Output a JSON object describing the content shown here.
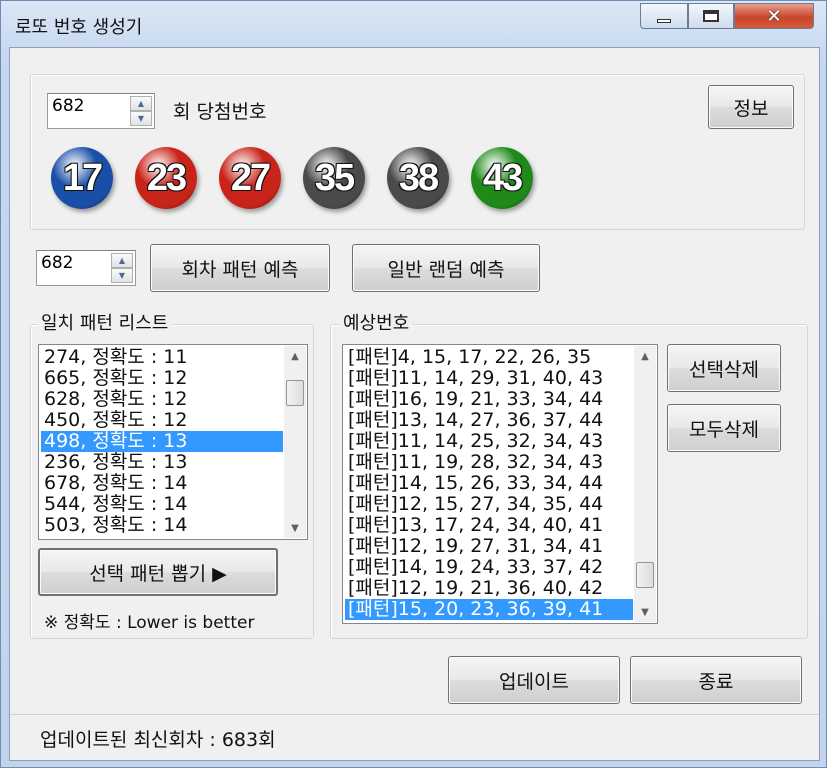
{
  "window": {
    "title": "로또 번호 생성기"
  },
  "top": {
    "round_value": "682",
    "round_suffix": "회 당첨번호",
    "info_button": "정보",
    "balls": [
      {
        "number": "17",
        "color": "#1a4fa8"
      },
      {
        "number": "23",
        "color": "#c9241a"
      },
      {
        "number": "27",
        "color": "#c9241a"
      },
      {
        "number": "35",
        "color": "#4a4a4a"
      },
      {
        "number": "38",
        "color": "#4a4a4a"
      },
      {
        "number": "43",
        "color": "#1f8a1a"
      }
    ]
  },
  "predict": {
    "round_value": "682",
    "pattern_button": "회차 패턴 예측",
    "random_button": "일반 랜덤 예측"
  },
  "pattern_list": {
    "label": "일치 패턴 리스트",
    "items": [
      "274, 정확도 : 11",
      "665, 정확도 : 12",
      "628, 정확도 : 12",
      "450, 정확도 : 12",
      "498, 정확도 : 13",
      "236, 정확도 : 13",
      "678, 정확도 : 14",
      "544, 정확도 : 14",
      "503, 정확도 : 14"
    ],
    "selected_index": 4,
    "extract_button": "선택 패턴 뽑기 ▶",
    "note": "※ 정확도 : Lower is better"
  },
  "predicted": {
    "label": "예상번호",
    "items": [
      "[패턴]4, 15, 17, 22, 26, 35",
      "[패턴]11, 14, 29, 31, 40, 43",
      "[패턴]16, 19, 21, 33, 34, 44",
      "[패턴]13, 14, 27, 36, 37, 44",
      "[패턴]11, 14, 25, 32, 34, 43",
      "[패턴]11, 19, 28, 32, 34, 43",
      "[패턴]14, 15, 26, 33, 34, 44",
      "[패턴]12, 15, 27, 34, 35, 44",
      "[패턴]13, 17, 24, 34, 40, 41",
      "[패턴]12, 19, 27, 31, 34, 41",
      "[패턴]14, 19, 24, 33, 37, 42",
      "[패턴]12, 19, 21, 36, 40, 42",
      "[패턴]15, 20, 23, 36, 39, 41"
    ],
    "selected_index": 12,
    "delete_selected_button": "선택삭제",
    "delete_all_button": "모두삭제"
  },
  "footer": {
    "update_button": "업데이트",
    "exit_button": "종료",
    "status": "업데이트된 최신회차 : 683회"
  }
}
